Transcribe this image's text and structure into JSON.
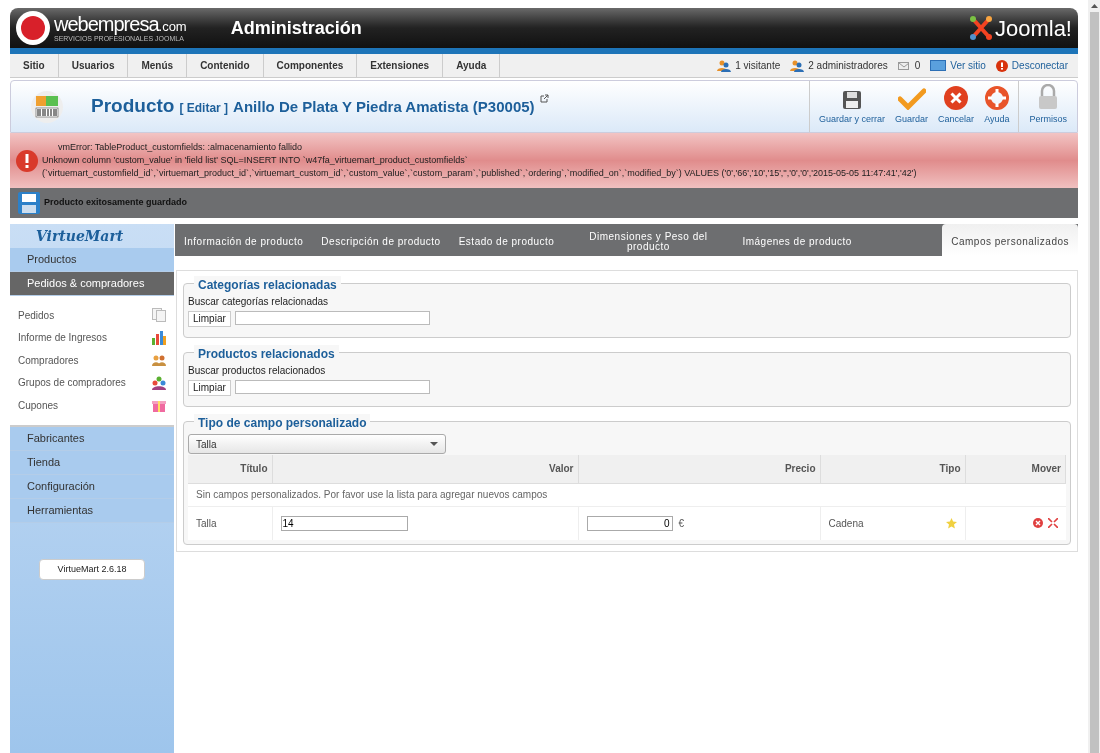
{
  "header": {
    "logo_name": "webempresa",
    "logo_suffix": ".com",
    "logo_tagline": "SERVICIOS PROFESIONALES JOOMLA",
    "title": "Administración",
    "brand": "Joomla!"
  },
  "menu": [
    "Sitio",
    "Usuarios",
    "Menús",
    "Contenido",
    "Componentes",
    "Extensiones",
    "Ayuda"
  ],
  "status": [
    {
      "kind": "visitors",
      "text": "1 visitante"
    },
    {
      "kind": "admins",
      "text": "2 administradores"
    },
    {
      "kind": "messages",
      "text": "0"
    },
    {
      "kind": "site",
      "text": "Ver sitio"
    },
    {
      "kind": "logout",
      "text": "Desconectar"
    }
  ],
  "toolbar": {
    "title": "Producto",
    "edit": "[ Editar ]",
    "product": "Anillo De Plata Y Piedra Amatista (P30005)",
    "buttons": [
      {
        "kind": "save-close",
        "label": "Guardar y cerrar"
      },
      {
        "kind": "save",
        "label": "Guardar"
      },
      {
        "kind": "cancel",
        "label": "Cancelar"
      },
      {
        "kind": "help",
        "label": "Ayuda"
      },
      {
        "kind": "permissions",
        "label": "Permisos"
      }
    ]
  },
  "error": [
    "vmError: TableProduct_customfields: :almacenamiento fallido",
    "Unknown column 'custom_value' in 'field list' SQL=INSERT INTO `w47fa_virtuemart_product_customfields`",
    "(`virtuemart_customfield_id`,`virtuemart_product_id`,`virtuemart_custom_id`,`custom_value`,`custom_param`,`published`,`ordering`,`modified_on`,`modified_by`) VALUES ('0','66','10','15','','0','0','2015-05-05 11:47:41','42')"
  ],
  "success": "Producto exitosamente guardado",
  "sidebar": {
    "logo": "VirtueMart",
    "sections": [
      {
        "label": "Productos",
        "expanded": false
      },
      {
        "label": "Pedidos & compradores",
        "expanded": true,
        "items": [
          {
            "kind": "orders",
            "label": "Pedidos"
          },
          {
            "kind": "report",
            "label": "Informe de Ingresos"
          },
          {
            "kind": "buyers",
            "label": "Compradores"
          },
          {
            "kind": "groups",
            "label": "Grupos de compradores"
          },
          {
            "kind": "coupons",
            "label": "Cupones"
          }
        ]
      },
      {
        "label": "Fabricantes",
        "expanded": false
      },
      {
        "label": "Tienda",
        "expanded": false
      },
      {
        "label": "Configuración",
        "expanded": false
      },
      {
        "label": "Herramientas",
        "expanded": false
      }
    ],
    "version": "VirtueMart 2.6.18"
  },
  "tabs": [
    {
      "label": "Información de producto",
      "selected": false
    },
    {
      "label": "Descripción de producto",
      "selected": false
    },
    {
      "label": "Estado de producto",
      "selected": false
    },
    {
      "label": "Dimensiones y Peso del producto",
      "selected": false
    },
    {
      "label": "Imágenes de producto",
      "selected": false
    },
    {
      "label": "Campos personalizados",
      "selected": true
    }
  ],
  "related": [
    {
      "legend": "Categorías relacionadas",
      "label": "Buscar categorías relacionadas",
      "button": "Limpiar"
    },
    {
      "legend": "Productos relacionados",
      "label": "Buscar productos relacionados",
      "button": "Limpiar"
    }
  ],
  "custom": {
    "legend": "Tipo de campo personalizado",
    "select": "Talla",
    "columns": [
      "Título",
      "Valor",
      "Precio",
      "Tipo",
      "Mover"
    ],
    "empty": "Sin campos personalizados. Por favor use la lista para agregar nuevos campos",
    "rows": [
      {
        "title": "Talla",
        "value": "14",
        "price": "0",
        "currency": "€",
        "type": "Cadena"
      }
    ]
  }
}
